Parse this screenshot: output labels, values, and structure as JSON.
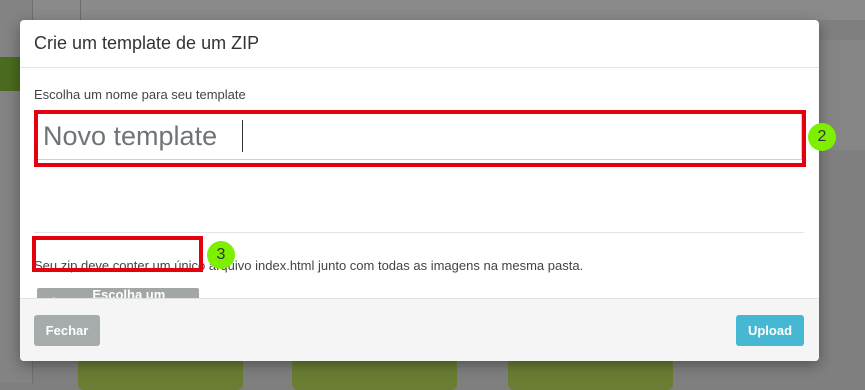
{
  "modal": {
    "title": "Crie um template de um ZIP",
    "name_label": "Escolha um nome para seu template",
    "name_input": {
      "value": "",
      "placeholder": "Novo template"
    },
    "help_text": "Seu zip deve conter um único arquivo index.html junto com todas as imagens na mesma pasta.",
    "choose_file_label": "Escolha um arquivo",
    "choose_file_icon": "cloud-upload-icon",
    "close_label": "Fechar",
    "upload_label": "Upload"
  },
  "annotations": {
    "step_2": "2",
    "step_3": "3"
  },
  "colors": {
    "highlight": "#e3000f",
    "step_badge": "#7cf000",
    "upload_button": "#46b8d1",
    "secondary_button": "#a6abab"
  }
}
